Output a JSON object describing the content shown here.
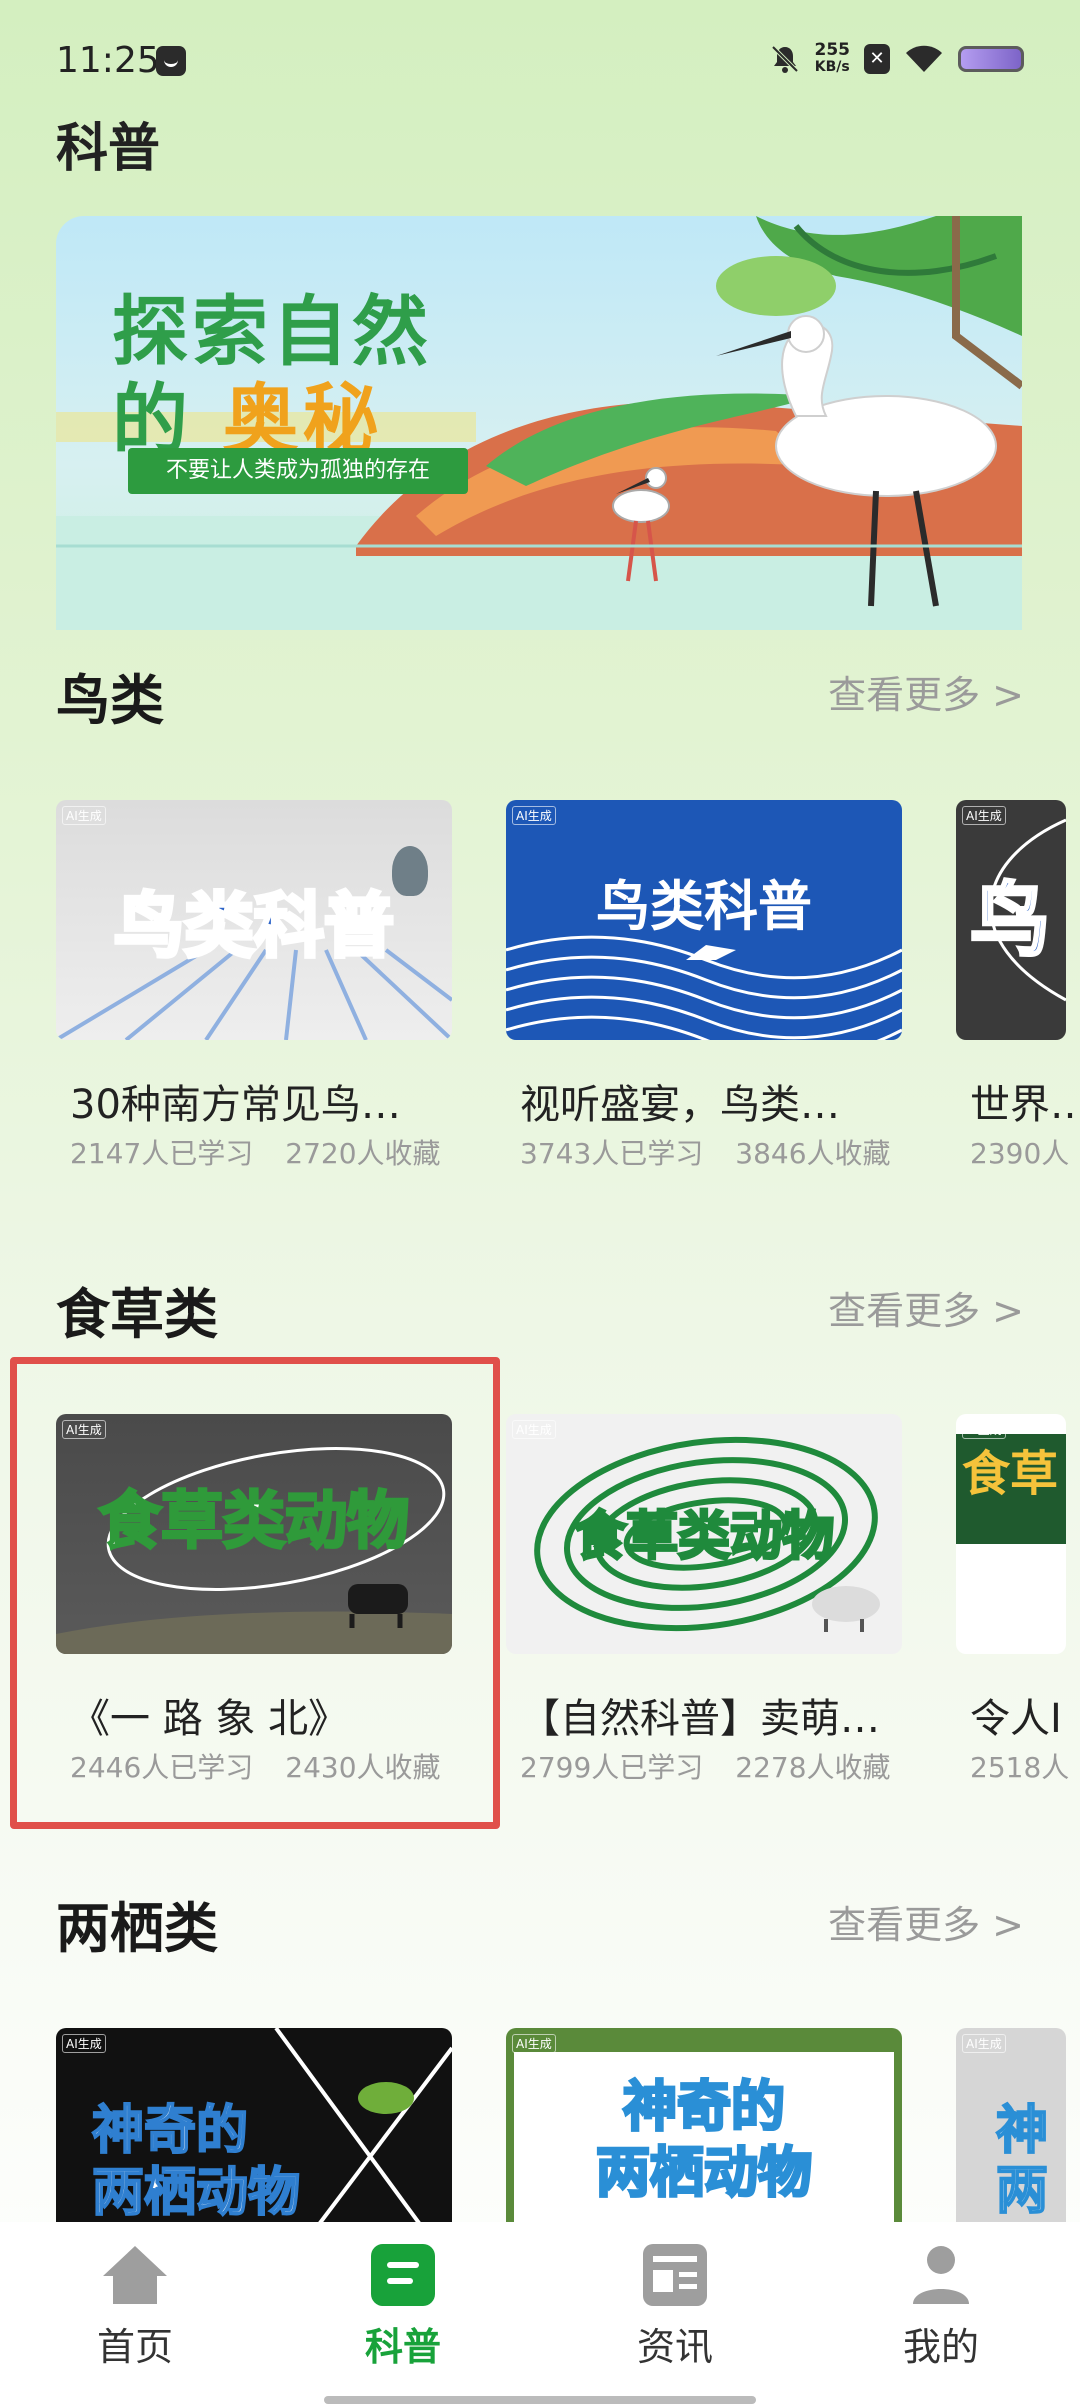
{
  "status_bar": {
    "time": "11:25",
    "net_speed_value": "255",
    "net_speed_unit": "KB/s",
    "sim_label": "✕"
  },
  "page_title": "科普",
  "banner": {
    "line1": "探索自然",
    "line2_part1": "的",
    "line2_part2": "奥秘",
    "tagline": "不要让人类成为孤独的存在"
  },
  "sections": {
    "birds": {
      "title": "鸟类",
      "more": "查看更多 >",
      "cards": [
        {
          "thumb_text": "鸟类科普",
          "title": "30种南方常见鸟…",
          "learned": "2147人已学习",
          "saved": "2720人收藏"
        },
        {
          "thumb_text": "鸟类科普",
          "title": "视听盛宴，鸟类…",
          "learned": "3743人已学习",
          "saved": "3846人收藏"
        },
        {
          "thumb_text": "鸟",
          "title": "世界…",
          "learned": "2390人",
          "saved": ""
        }
      ]
    },
    "herbivores": {
      "title": "食草类",
      "more": "查看更多 >",
      "cards": [
        {
          "thumb_text": "食草类动物",
          "title": "《一 路 象 北》",
          "learned": "2446人已学习",
          "saved": "2430人收藏"
        },
        {
          "thumb_text": "食草类动物",
          "title": "【自然科普】卖萌…",
          "learned": "2799人已学习",
          "saved": "2278人收藏"
        },
        {
          "thumb_text": "食草",
          "title": "令人I",
          "learned": "2518人",
          "saved": ""
        }
      ]
    },
    "amphibians": {
      "title": "两栖类",
      "more": "查看更多 >",
      "cards": [
        {
          "thumb_text_1": "神奇的",
          "thumb_text_2": "两栖动物"
        },
        {
          "thumb_text_1": "神奇的",
          "thumb_text_2": "两栖动物"
        },
        {
          "thumb_text_1": "神",
          "thumb_text_2": "两"
        }
      ]
    }
  },
  "ai_badge": "AI生成",
  "tabbar": {
    "items": [
      {
        "label": "首页",
        "icon": "home-icon"
      },
      {
        "label": "科普",
        "icon": "science-icon"
      },
      {
        "label": "资讯",
        "icon": "news-icon"
      },
      {
        "label": "我的",
        "icon": "profile-icon"
      }
    ],
    "active_index": 1,
    "active_color": "#18a23a"
  }
}
